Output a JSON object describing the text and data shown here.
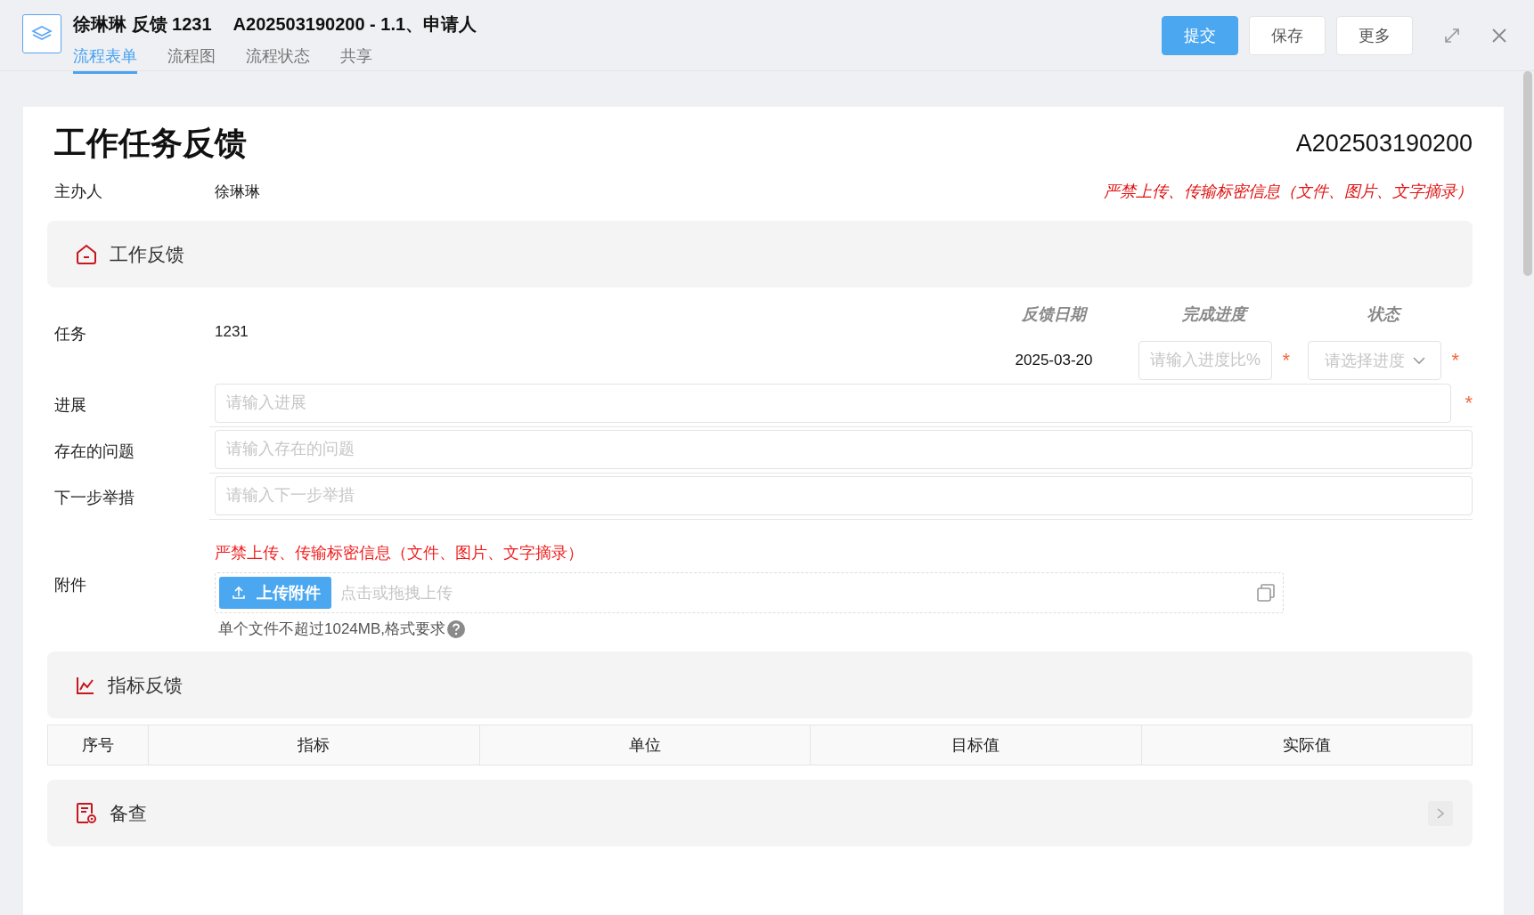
{
  "header": {
    "title": "徐琳琳 反馈 1231",
    "subtitle": "A202503190200 - 1.1、申请人",
    "tabs": [
      {
        "label": "流程表单",
        "selected": true
      },
      {
        "label": "流程图",
        "selected": false
      },
      {
        "label": "流程状态",
        "selected": false
      },
      {
        "label": "共享",
        "selected": false
      }
    ],
    "buttons": [
      {
        "label": "提交",
        "kind": "primary"
      },
      {
        "label": "保存",
        "kind": "default"
      },
      {
        "label": "更多",
        "kind": "default"
      }
    ]
  },
  "form": {
    "title": "工作任务反馈",
    "number": "A202503190200",
    "host_label": "主办人",
    "host_value": "徐琳琳",
    "notice": "严禁上传、传输标密信息（文件、图片、文字摘录）"
  },
  "work_feedback": {
    "title": "工作反馈",
    "required_mark": "*",
    "task_label": "任务",
    "task_value": "1231",
    "columns": [
      "反馈日期",
      "完成进度",
      "状态"
    ],
    "date": "2025-03-20",
    "progress": {
      "placeholder": "请输入进度比%",
      "required": true
    },
    "status": {
      "placeholder": "请选择进度",
      "required": true
    },
    "fields": [
      {
        "label": "进展",
        "placeholder": "请输入进展",
        "required": true
      },
      {
        "label": "存在的问题",
        "placeholder": "请输入存在的问题",
        "required": false
      },
      {
        "label": "下一步举措",
        "placeholder": "请输入下一步举措",
        "required": false
      }
    ],
    "attachment": {
      "label": "附件",
      "notice": "严禁上传、传输标密信息（文件、图片、文字摘录）",
      "button": "上传附件",
      "drop_hint": "点击或拖拽上传",
      "size_hint": "单个文件不超过1024MB,格式要求"
    }
  },
  "indicator_feedback": {
    "title": "指标反馈",
    "columns": [
      "序号",
      "指标",
      "单位",
      "目标值",
      "实际值"
    ]
  },
  "review": {
    "title": "备查"
  }
}
